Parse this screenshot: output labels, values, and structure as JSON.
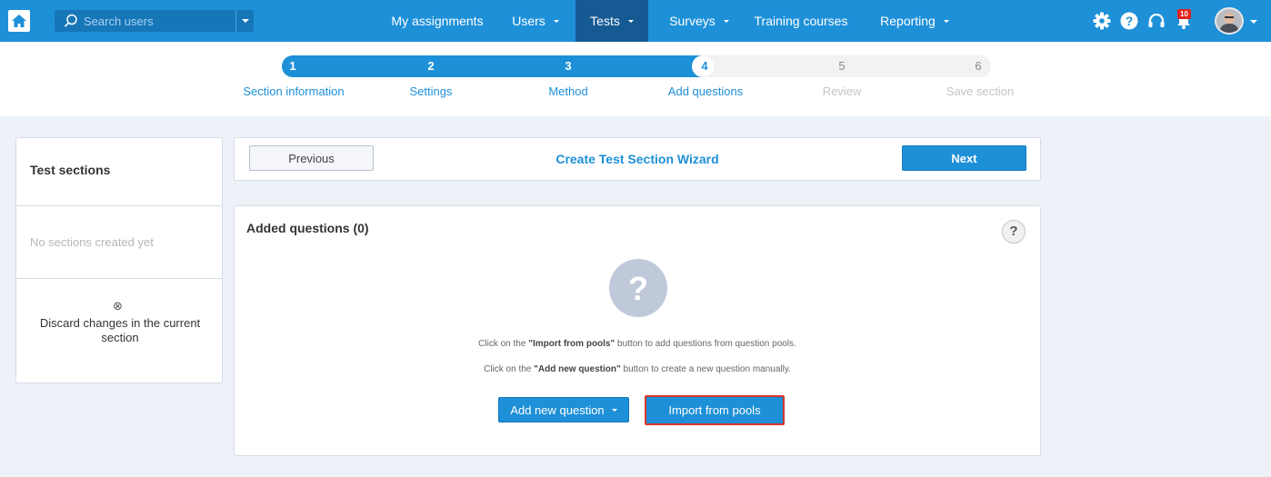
{
  "topbar": {
    "search_placeholder": "Search users",
    "nav": [
      {
        "label": "My assignments",
        "dropdown": false,
        "active": false
      },
      {
        "label": "Users",
        "dropdown": true,
        "active": false
      },
      {
        "label": "Tests",
        "dropdown": true,
        "active": true
      },
      {
        "label": "Surveys",
        "dropdown": true,
        "active": false
      },
      {
        "label": "Training courses",
        "dropdown": false,
        "active": false
      },
      {
        "label": "Reporting",
        "dropdown": true,
        "active": false
      }
    ],
    "notification_count": "10",
    "icons": [
      "home-icon",
      "search-icon",
      "gear-icon",
      "help-icon",
      "headset-icon",
      "notification-bell-icon",
      "avatar"
    ]
  },
  "stepper": {
    "steps": [
      {
        "num": "1",
        "label": "Section information",
        "state": "done"
      },
      {
        "num": "2",
        "label": "Settings",
        "state": "done"
      },
      {
        "num": "3",
        "label": "Method",
        "state": "done"
      },
      {
        "num": "4",
        "label": "Add questions",
        "state": "current"
      },
      {
        "num": "5",
        "label": "Review",
        "state": "todo"
      },
      {
        "num": "6",
        "label": "Save section",
        "state": "todo"
      }
    ]
  },
  "sidebar": {
    "title": "Test sections",
    "empty_text": "No sections created yet",
    "discard_label": "Discard changes in the current section"
  },
  "wizard": {
    "previous_label": "Previous",
    "title": "Create Test Section Wizard",
    "next_label": "Next"
  },
  "questions": {
    "title": "Added questions (0)",
    "hint1_pre": "Click on the ",
    "hint1_bold": "\"Import from pools\"",
    "hint1_post": " button to add questions from question pools.",
    "hint2_pre": "Click on the ",
    "hint2_bold": "\"Add new question\"",
    "hint2_post": " button to create a new question manually.",
    "add_new_label": "Add new question",
    "import_label": "Import from pools"
  },
  "colors": {
    "primary": "#1e90d8",
    "active_nav": "#155a93",
    "highlight_border": "#d7352b",
    "content_bg": "#edf1f8"
  }
}
